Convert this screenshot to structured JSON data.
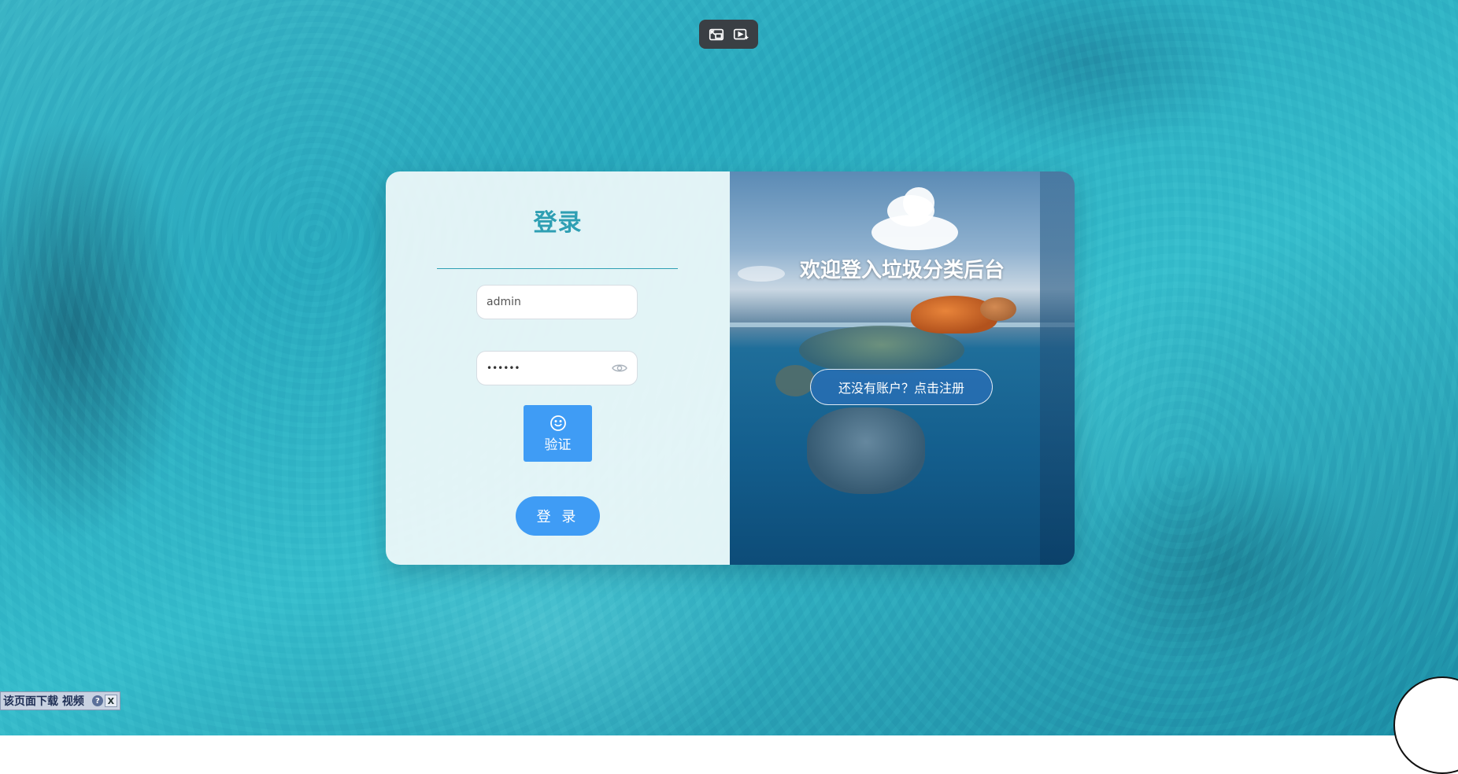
{
  "login": {
    "title": "登录",
    "username_value": "admin",
    "password_value": "••••••",
    "verify_label": "验证",
    "login_label": "登 录"
  },
  "banner": {
    "welcome": "欢迎登入垃圾分类后台",
    "register_label": "还没有账户？点击注册"
  },
  "download_bar": {
    "label": "该页面下载 视频",
    "help": "?",
    "close": "X"
  },
  "icons": {
    "video_controls": [
      "exit-pip-icon",
      "video-enhance-icon"
    ],
    "password_toggle": "eye-icon",
    "verify": "smile-icon"
  },
  "colors": {
    "accent": "#3f9cf5",
    "title": "#2e9fb3"
  }
}
